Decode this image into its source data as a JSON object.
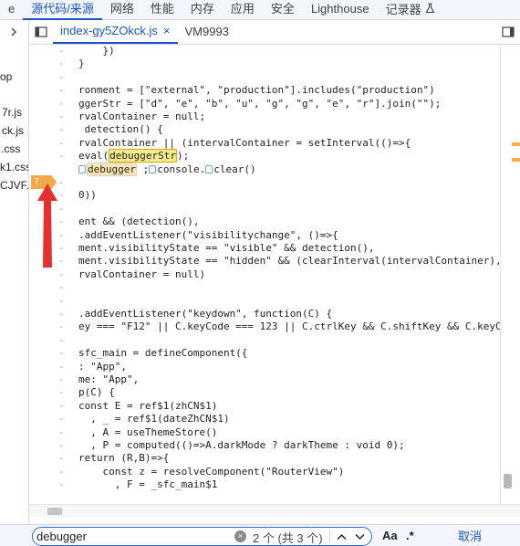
{
  "top_tabs": [
    {
      "label": "e"
    },
    {
      "label": "源代码/来源",
      "active": true
    },
    {
      "label": "网络"
    },
    {
      "label": "性能"
    },
    {
      "label": "内存"
    },
    {
      "label": "应用"
    },
    {
      "label": "安全"
    },
    {
      "label": "Lighthouse"
    },
    {
      "label": "记录器"
    }
  ],
  "file_tabs": {
    "active_file": "index-gy5ZOkck.js",
    "other_file": "VM9993",
    "close_glyph": "×"
  },
  "navigator": {
    "toggle_glyph": "›",
    "items": [
      "op",
      "7r.js",
      "ck.js",
      ".css",
      "k1.css",
      "CJVF.p"
    ]
  },
  "gutter": {
    "breakpoint_label": "?",
    "breakpoint_dash": "-"
  },
  "code_lines": [
    "    })",
    "}",
    "",
    "ronment = [\"external\", \"production\"].includes(\"production\")",
    "ggerStr = [\"d\", \"e\", \"b\", \"u\", \"g\", \"g\", \"e\", \"r\"].join(\"\");",
    "rvalContainer = null;",
    " detection() {",
    "rvalContainer || (intervalContainer = setInterval(()=>{",
    "eval(debuggerStr);",
    "debugger ;console.clear()",
    "",
    "0))",
    "",
    "ent && (detection(),",
    ".addEventListener(\"visibilitychange\", ()=>{",
    "ment.visibilityState == \"visible\" && detection(),",
    "ment.visibilityState == \"hidden\" && (clearInterval(intervalContainer),",
    "rvalContainer = null)",
    "",
    "",
    ".addEventListener(\"keydown\", function(C) {",
    "ey === \"F12\" || C.keyCode === 123 || C.ctrlKey && C.shiftKey && C.keyC",
    "",
    "sfc_main = defineComponent({",
    ": \"App\",",
    "me: \"App\",",
    "p(C) {",
    "const E = ref$1(zhCN$1)",
    "  , _ = ref$1(dateZhCN$1)",
    "  , A = useThemeStore()",
    "  , P = computed(()=>A.darkMode ? darkTheme : void 0);",
    "return (R,B)=>{",
    "    const z = resolveComponent(\"RouterView\")",
    "      , F = _sfc_main$1"
  ],
  "code_segments": {
    "eval_pre": "eval(",
    "eval_hl": "debuggerStr",
    "eval_post": ");",
    "pause_kw": "debugger",
    "pause_post": " ;",
    "console_clear": "console.",
    "clear_call": "clear()"
  },
  "search": {
    "query": "debugger",
    "placeholder": "",
    "clear_glyph": "×",
    "count": "2 个 (共 3 个)",
    "prev_glyph": "⌃",
    "next_glyph": "⌄",
    "case_option": "Aa",
    "regex_option": ".*",
    "cancel_label": "取消"
  },
  "colors": {
    "accent": "#1a56c4",
    "highlight": "#f7e98e",
    "breakpoint": "#f2a94a",
    "annotation_arrow": "#e53030"
  }
}
